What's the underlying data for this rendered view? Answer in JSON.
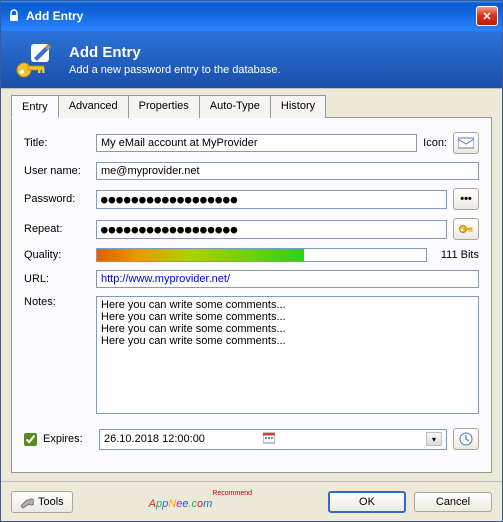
{
  "window": {
    "title": "Add Entry"
  },
  "banner": {
    "title": "Add Entry",
    "subtitle": "Add a new password entry to the database."
  },
  "tabs": [
    "Entry",
    "Advanced",
    "Properties",
    "Auto-Type",
    "History"
  ],
  "form": {
    "title_label": "Title:",
    "title_value": "My eMail account at MyProvider",
    "icon_label": "Icon:",
    "username_label": "User name:",
    "username_value": "me@myprovider.net",
    "password_label": "Password:",
    "password_value": "●●●●●●●●●●●●●●●●●●",
    "repeat_label": "Repeat:",
    "repeat_value": "●●●●●●●●●●●●●●●●●●",
    "quality_label": "Quality:",
    "quality_bits": "111 Bits",
    "url_label": "URL:",
    "url_value": "http://www.myprovider.net/",
    "notes_label": "Notes:",
    "notes_value": "Here you can write some comments...\nHere you can write some comments...\nHere you can write some comments...\nHere you can write some comments...",
    "expires_label": "Expires:",
    "expires_value": "26.10.2018 12:00:00",
    "expires_checked": true
  },
  "footer": {
    "tools_label": "Tools",
    "ok_label": "OK",
    "cancel_label": "Cancel",
    "watermark": "AppNee.com",
    "watermark_badge": "Recommend"
  }
}
